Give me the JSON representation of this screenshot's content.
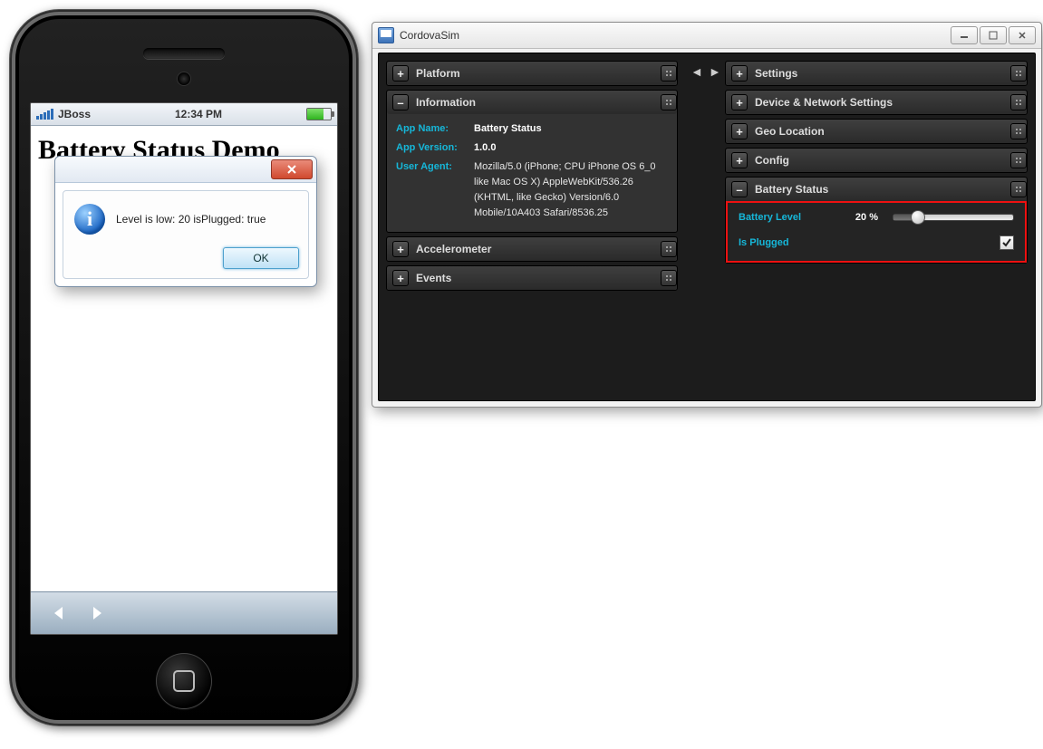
{
  "phone": {
    "carrier": "JBoss",
    "time": "12:34 PM",
    "page_title": "Battery Status Demo",
    "alert": {
      "message": "Level is low: 20 isPlugged: true",
      "ok": "OK"
    }
  },
  "window": {
    "title": "CordovaSim",
    "left_panels": {
      "platform": "Platform",
      "information": {
        "title": "Information",
        "app_name_label": "App Name:",
        "app_name": "Battery Status",
        "app_version_label": "App Version:",
        "app_version": "1.0.0",
        "user_agent_label": "User Agent:",
        "user_agent": "Mozilla/5.0 (iPhone; CPU iPhone OS 6_0 like Mac OS X) AppleWebKit/536.26 (KHTML, like Gecko) Version/6.0 Mobile/10A403 Safari/8536.25"
      },
      "accelerometer": "Accelerometer",
      "events": "Events"
    },
    "right_panels": {
      "settings": "Settings",
      "device_network": "Device & Network Settings",
      "geo": "Geo Location",
      "config": "Config",
      "battery": {
        "title": "Battery Status",
        "level_label": "Battery Level",
        "level_value": "20 %",
        "plugged_label": "Is Plugged",
        "plugged_checked": true
      }
    }
  }
}
